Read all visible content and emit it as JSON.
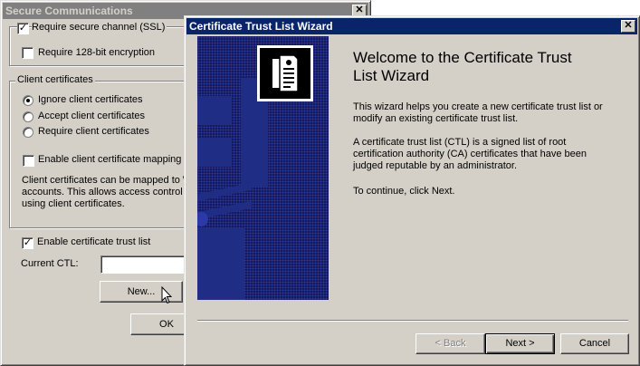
{
  "secure_window": {
    "title": "Secure Communications",
    "close_glyph": "✕",
    "require_ssl": {
      "label": "Require secure channel (SSL)",
      "checked": true
    },
    "require_128": {
      "label": "Require 128-bit encryption",
      "checked": false
    },
    "client_group_label": "Client certificates",
    "radios": [
      {
        "label": "Ignore client certificates",
        "selected": true
      },
      {
        "label": "Accept client certificates",
        "selected": false
      },
      {
        "label": "Require client certificates",
        "selected": false
      }
    ],
    "enable_mapping": {
      "label": "Enable client certificate mapping",
      "checked": false
    },
    "mapping_text": [
      "Client certificates can be mapped to W",
      "accounts.  This allows access control",
      "using client certificates."
    ],
    "enable_ctl": {
      "label": "Enable certificate trust list",
      "checked": true
    },
    "current_ctl_label": "Current CTL:",
    "current_ctl_value": "",
    "new_button": "New...",
    "ok_button": "OK"
  },
  "wizard": {
    "title": "Certificate Trust List Wizard",
    "close_glyph": "✕",
    "heading_line1": "Welcome to the Certificate Trust",
    "heading_line2": "List Wizard",
    "para1": "This wizard helps you create a new certificate trust list or modify an existing certificate trust list.",
    "para2": "A certificate trust list (CTL) is a signed list of root certification authority (CA) certificates that have been judged reputable by an administrator.",
    "para3": "To continue, click Next.",
    "back_button": "< Back",
    "next_button": "Next >",
    "cancel_button": "Cancel",
    "panel_icon": "certificate-list-icon"
  },
  "colors": {
    "active_title": "#0a246a",
    "inactive_title": "#808080",
    "face": "#d4d0c8",
    "panel": "#16195e"
  }
}
